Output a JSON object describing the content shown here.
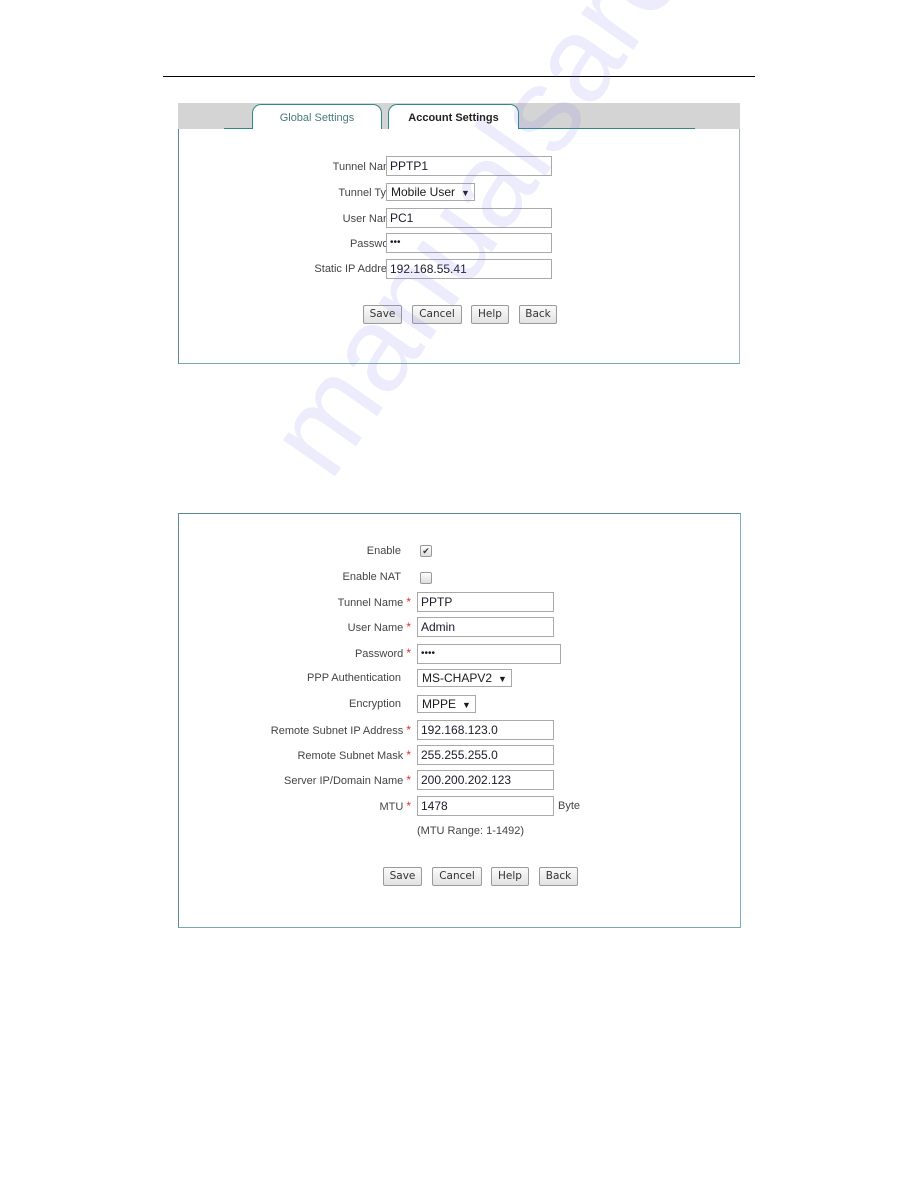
{
  "account_panel": {
    "tabs": [
      {
        "label": "Global Settings",
        "active": false
      },
      {
        "label": "Account Settings",
        "active": true
      }
    ],
    "required_marker": "*",
    "fields": {
      "tunnel_name": {
        "label": "Tunnel Name",
        "value": "PPTP1",
        "required": true
      },
      "tunnel_type": {
        "label": "Tunnel Type",
        "value": "Mobile User",
        "required": true
      },
      "user_name": {
        "label": "User Name",
        "value": "PC1",
        "required": true
      },
      "password": {
        "label": "Password",
        "value": "•••",
        "required": true
      },
      "static_ip": {
        "label": "Static IP Address",
        "value": "192.168.55.41",
        "required": false
      }
    },
    "buttons": {
      "save": "Save",
      "cancel": "Cancel",
      "help": "Help",
      "back": "Back"
    }
  },
  "client_panel": {
    "required_marker": "*",
    "enable": {
      "label": "Enable",
      "checked": true,
      "glyph": "✔"
    },
    "enable_nat": {
      "label": "Enable NAT",
      "checked": false
    },
    "fields": {
      "tunnel_name": {
        "label": "Tunnel Name",
        "value": "PPTP"
      },
      "user_name": {
        "label": "User Name",
        "value": "Admin"
      },
      "password": {
        "label": "Password",
        "value": "••••"
      },
      "ppp_auth": {
        "label": "PPP Authentication",
        "value": "MS-CHAPV2"
      },
      "encryption": {
        "label": "Encryption",
        "value": "MPPE"
      },
      "remote_subnet_ip": {
        "label": "Remote Subnet IP Address",
        "value": "192.168.123.0"
      },
      "remote_subnet_mask": {
        "label": "Remote Subnet Mask",
        "value": "255.255.255.0"
      },
      "server_ip": {
        "label": "Server IP/Domain Name",
        "value": "200.200.202.123"
      },
      "mtu": {
        "label": "MTU",
        "value": "1478",
        "unit": "Byte",
        "range_note": "(MTU Range: 1-1492)"
      }
    },
    "buttons": {
      "save": "Save",
      "cancel": "Cancel",
      "help": "Help",
      "back": "Back"
    }
  },
  "icons": {
    "dropdown_arrow": "▼"
  },
  "watermark": "manualsarchive.com"
}
